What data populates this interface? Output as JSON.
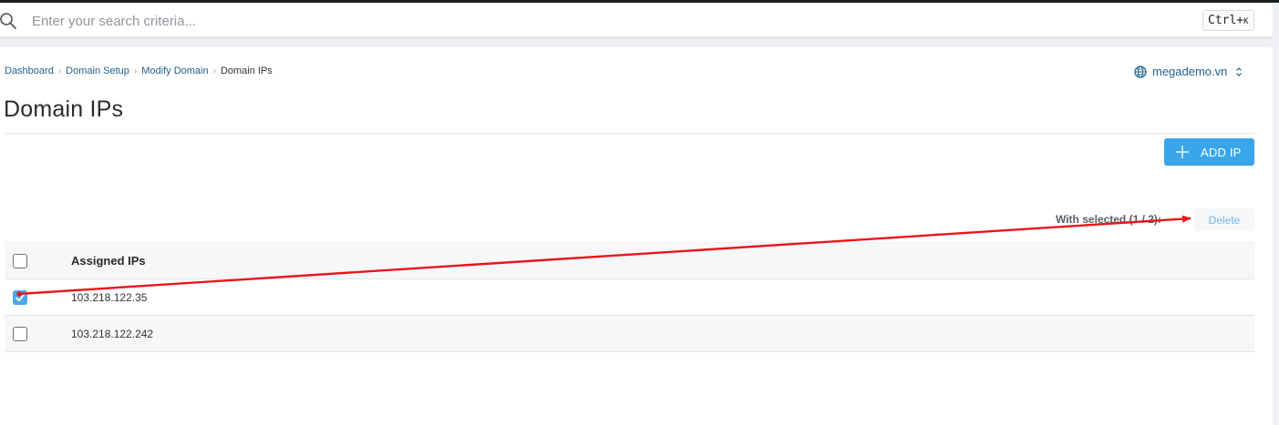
{
  "search": {
    "placeholder": "Enter your search criteria...",
    "shortcut_main": "Ctrl+",
    "shortcut_key": "K"
  },
  "breadcrumb": [
    {
      "label": "Dashboard"
    },
    {
      "label": "Domain Setup"
    },
    {
      "label": "Modify Domain"
    },
    {
      "label": "Domain IPs"
    }
  ],
  "domain_selector": {
    "value": "megademo.vn",
    "icon": "globe-icon"
  },
  "page": {
    "title": "Domain IPs"
  },
  "toolbar": {
    "add_label": "ADD IP",
    "with_selected": "With selected (1 / 2):",
    "delete_label": "Delete"
  },
  "table": {
    "header": "Assigned IPs",
    "rows": [
      {
        "ip": "103.218.122.35",
        "checked": true
      },
      {
        "ip": "103.218.122.242",
        "checked": false
      }
    ]
  },
  "colors": {
    "accent": "#3aa6ea",
    "link": "#1f5f90",
    "annotation_arrow": "#e8151b"
  }
}
